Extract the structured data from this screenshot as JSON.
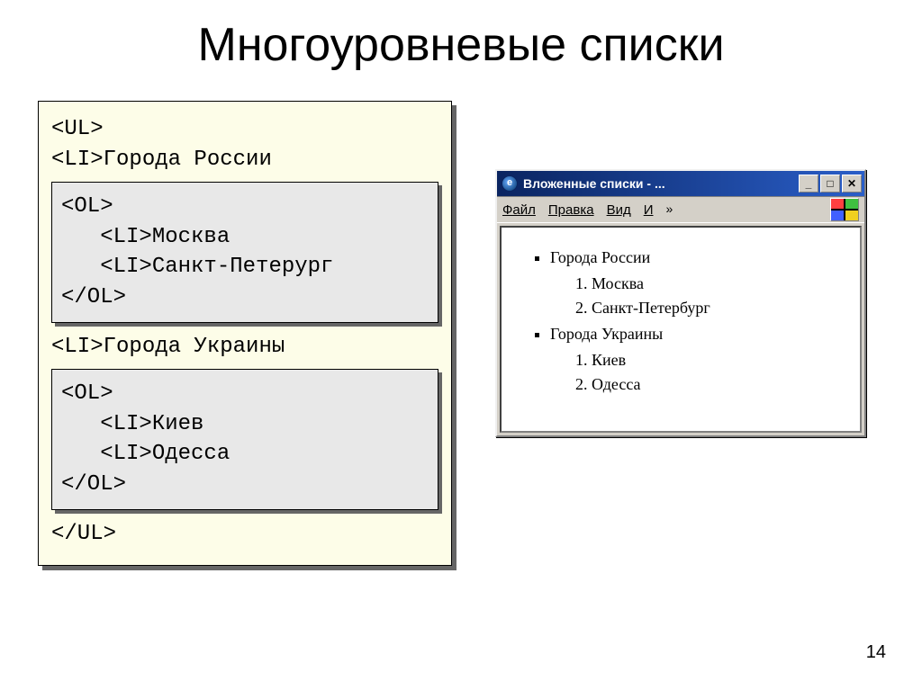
{
  "title": "Многоуровневые списки",
  "slideNumber": "14",
  "code": {
    "ul_open": "<UL>",
    "li_russia": "<LI>Города России",
    "russia_block": {
      "ol_open": "<OL>",
      "li_moscow": "   <LI>Москва",
      "li_spb": "   <LI>Санкт-Петерург",
      "ol_close": "</OL>"
    },
    "li_ukraine": "<LI>Города Украины",
    "ukraine_block": {
      "ol_open": "<OL>",
      "li_kiev": "   <LI>Киев",
      "li_odessa": "   <LI>Одесса",
      "ol_close": "</OL>"
    },
    "ul_close": "</UL>"
  },
  "browser": {
    "title": "Вложенные списки - ...",
    "menu": {
      "file": "Файл",
      "edit": "Правка",
      "view": "Вид",
      "more": "И"
    },
    "content": {
      "russia": "Города России",
      "moscow": "Москва",
      "spb": "Санкт-Петербург",
      "ukraine": "Города Украины",
      "kiev": "Киев",
      "odessa": "Одесса"
    }
  }
}
